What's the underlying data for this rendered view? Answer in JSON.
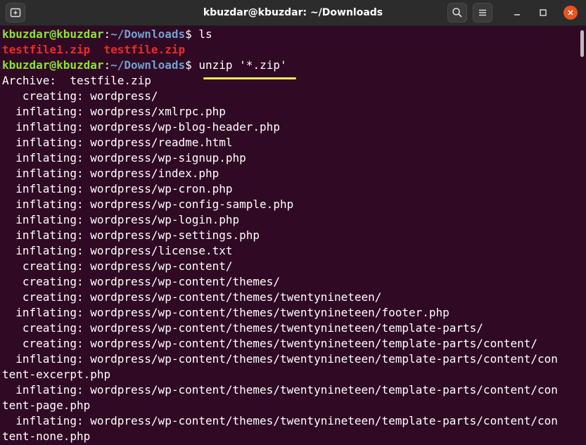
{
  "window": {
    "title": "kbuzdar@kbuzdar: ~/Downloads"
  },
  "icons": {
    "new_tab": "new-tab-icon",
    "search": "search-icon",
    "menu": "hamburger-menu-icon",
    "minimize": "minimize-icon",
    "maximize": "maximize-icon",
    "close": "close-icon"
  },
  "colors": {
    "terminal_bg": "#300a24",
    "prompt_user": "#8ae234",
    "prompt_path": "#729fcf",
    "archive_file": "#ef2929",
    "highlight_underline": "#fce94f",
    "close_button": "#e95420"
  },
  "terminal": {
    "prompt1": {
      "user_host": "kbuzdar@kbuzdar",
      "separator": ":",
      "path": "~/Downloads",
      "symbol": "$ ",
      "command": "ls"
    },
    "ls_output": {
      "file1": "testfile1.zip",
      "gap": "  ",
      "file2": "testfile.zip"
    },
    "prompt2": {
      "user_host": "kbuzdar@kbuzdar",
      "separator": ":",
      "path": "~/Downloads",
      "symbol": "$ ",
      "command": "unzip '*.zip'"
    },
    "lines": [
      "Archive:  testfile.zip",
      "   creating: wordpress/",
      "  inflating: wordpress/xmlrpc.php",
      "  inflating: wordpress/wp-blog-header.php",
      "  inflating: wordpress/readme.html",
      "  inflating: wordpress/wp-signup.php",
      "  inflating: wordpress/index.php",
      "  inflating: wordpress/wp-cron.php",
      "  inflating: wordpress/wp-config-sample.php",
      "  inflating: wordpress/wp-login.php",
      "  inflating: wordpress/wp-settings.php",
      "  inflating: wordpress/license.txt",
      "   creating: wordpress/wp-content/",
      "   creating: wordpress/wp-content/themes/",
      "   creating: wordpress/wp-content/themes/twentynineteen/",
      "  inflating: wordpress/wp-content/themes/twentynineteen/footer.php",
      "   creating: wordpress/wp-content/themes/twentynineteen/template-parts/",
      "   creating: wordpress/wp-content/themes/twentynineteen/template-parts/content/",
      "  inflating: wordpress/wp-content/themes/twentynineteen/template-parts/content/con",
      "tent-excerpt.php",
      "  inflating: wordpress/wp-content/themes/twentynineteen/template-parts/content/con",
      "tent-page.php",
      "  inflating: wordpress/wp-content/themes/twentynineteen/template-parts/content/con",
      "tent-none.php"
    ]
  }
}
